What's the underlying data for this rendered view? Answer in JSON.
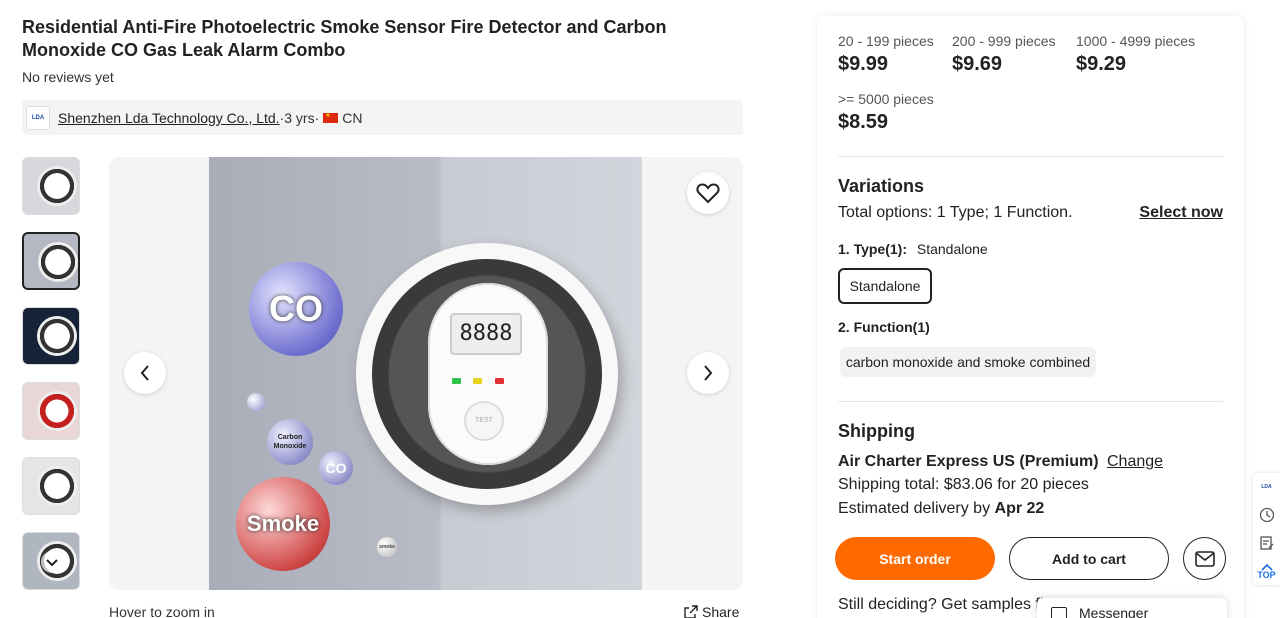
{
  "product": {
    "title": "Residential Anti-Fire Photoelectric Smoke Sensor Fire Detector and Carbon Monoxide CO Gas Leak Alarm Combo",
    "reviews": "No reviews yet"
  },
  "supplier": {
    "logo_text": "LDA",
    "name": "Shenzhen Lda Technology Co., Ltd.",
    "sep1": " · ",
    "years": "3 yrs",
    "sep2": " · ",
    "country": "CN"
  },
  "gallery": {
    "thumb_count": 6,
    "active_index": 1,
    "zoom_hint": "Hover to zoom in",
    "share_label": "Share",
    "image_text": {
      "bubble_co": "CO",
      "bubble_smoke": "Smoke",
      "bubble_carbon": "Carbon Monoxide",
      "bubble_co_small": "CO",
      "bubble_tiny": "smoke",
      "lcd": "8888",
      "test_button": "TEST"
    }
  },
  "pricing": {
    "tiers": [
      {
        "qty": "20 - 199 pieces",
        "price": "$9.99"
      },
      {
        "qty": "200 - 999 pieces",
        "price": "$9.69"
      },
      {
        "qty": "1000 - 4999 pieces",
        "price": "$9.29"
      },
      {
        "qty": ">= 5000 pieces",
        "price": "$8.59"
      }
    ]
  },
  "variations": {
    "title": "Variations",
    "total_options": "Total options: 1 Type; 1 Function.",
    "select_now": "Select now",
    "type_label": "1. Type(1):",
    "type_value": "Standalone",
    "type_option": "Standalone",
    "function_label": "2. Function(1)",
    "function_option": "carbon monoxide and smoke combined"
  },
  "shipping": {
    "title": "Shipping",
    "method": "Air Charter Express US (Premium)",
    "change_label": "Change",
    "total": "Shipping total: $83.06 for 20 pieces",
    "est_prefix": "Estimated delivery by ",
    "est_date": "Apr 22"
  },
  "actions": {
    "start_order": "Start order",
    "add_to_cart": "Add to cart",
    "samples_text": "Still deciding? Get samples fir"
  },
  "messenger": {
    "label": "Messenger"
  },
  "side_toolbar": {
    "logo": "LDA",
    "top_label": "TOP"
  },
  "colors": {
    "accent": "#ff6a00",
    "text": "#222222",
    "panel_bg": "#ffffff",
    "chip_bg": "#f2f2f2",
    "flag_red": "#de2910"
  }
}
